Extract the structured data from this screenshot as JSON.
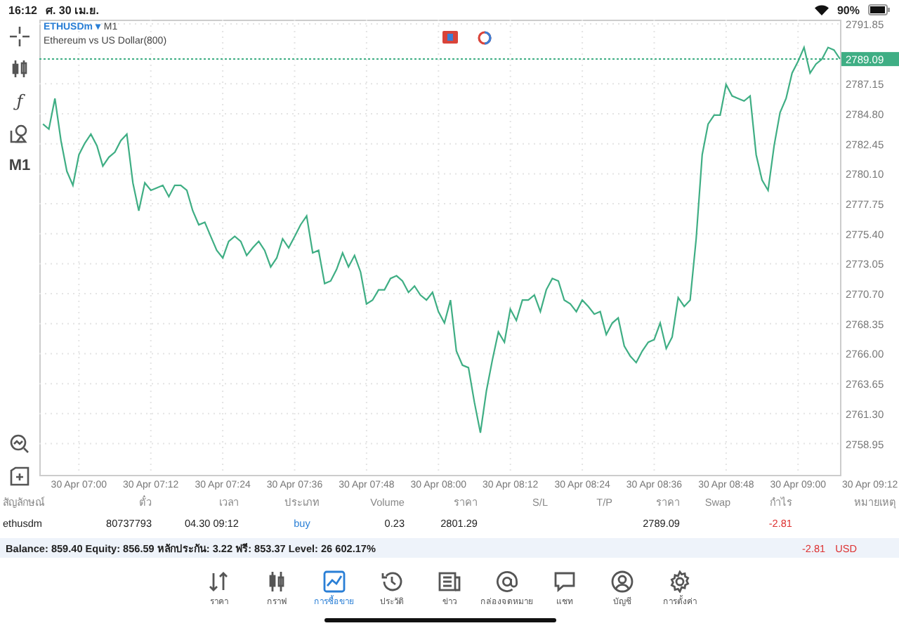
{
  "status_bar": {
    "time": "16:12",
    "date": "ศ. 30 เม.ย.",
    "battery": "90%"
  },
  "toolbar": [
    {
      "kind": "crosshair"
    },
    {
      "kind": "candles"
    },
    {
      "kind": "text",
      "label": "ƒ"
    },
    {
      "kind": "objects"
    },
    {
      "kind": "text",
      "label": "M1"
    }
  ],
  "toolbar_bottom": [
    {
      "kind": "zoom"
    },
    {
      "kind": "add"
    }
  ],
  "chart": {
    "caret": "▾",
    "timeframe": "M1",
    "description": "Ethereum vs US Dollar(800)",
    "chart_data": {
      "type": "line",
      "grid": true,
      "ylim": [
        2756.5,
        2792.18
      ],
      "yticks": [
        {
          "value": 2791.85,
          "label": "2791.85"
        },
        {
          "value": 2787.15,
          "label": "2787.15"
        },
        {
          "value": 2784.8,
          "label": "2784.80"
        },
        {
          "value": 2782.45,
          "label": "2782.45"
        },
        {
          "value": 2780.1,
          "label": "2780.10"
        },
        {
          "value": 2777.75,
          "label": "2777.75"
        },
        {
          "value": 2775.4,
          "label": "2775.40"
        },
        {
          "value": 2773.05,
          "label": "2773.05"
        },
        {
          "value": 2770.7,
          "label": "2770.70"
        },
        {
          "value": 2768.35,
          "label": "2768.35"
        },
        {
          "value": 2766.0,
          "label": "2766.00"
        },
        {
          "value": 2763.65,
          "label": "2763.65"
        },
        {
          "value": 2761.3,
          "label": "2761.30"
        },
        {
          "value": 2758.95,
          "label": "2758.95"
        }
      ],
      "categories": [
        null,
        null,
        null,
        null,
        null,
        null,
        "30 Apr 07:00",
        null,
        null,
        null,
        null,
        null,
        null,
        null,
        null,
        null,
        null,
        null,
        "30 Apr 07:12",
        null,
        null,
        null,
        null,
        null,
        null,
        null,
        null,
        null,
        null,
        null,
        "30 Apr 07:24",
        null,
        null,
        null,
        null,
        null,
        null,
        null,
        null,
        null,
        null,
        null,
        "30 Apr 07:36",
        null,
        null,
        null,
        null,
        null,
        null,
        null,
        null,
        null,
        null,
        null,
        "30 Apr 07:48",
        null,
        null,
        null,
        null,
        null,
        null,
        null,
        null,
        null,
        null,
        null,
        "30 Apr 08:00",
        null,
        null,
        null,
        null,
        null,
        null,
        null,
        null,
        null,
        null,
        null,
        "30 Apr 08:12",
        null,
        null,
        null,
        null,
        null,
        null,
        null,
        null,
        null,
        null,
        null,
        "30 Apr 08:24",
        null,
        null,
        null,
        null,
        null,
        null,
        null,
        null,
        null,
        null,
        null,
        "30 Apr 08:36",
        null,
        null,
        null,
        null,
        null,
        null,
        null,
        null,
        null,
        null,
        null,
        "30 Apr 08:48",
        null,
        null,
        null,
        null,
        null,
        null,
        null,
        null,
        null,
        null,
        null,
        "30 Apr 09:00",
        null,
        null,
        null,
        null,
        null,
        null,
        null,
        null,
        null,
        null,
        null,
        "30 Apr 09:12"
      ],
      "ref_lines": [
        {
          "axis": "y",
          "value": 2789.09,
          "label": "2789.09",
          "color": "#3fae84"
        }
      ],
      "series": [
        {
          "name": "ETHUSDm",
          "color": "#3fae84",
          "values": [
            2784.0,
            2783.6,
            2786.0,
            2782.7,
            2780.3,
            2779.2,
            2781.6,
            2782.5,
            2783.2,
            2782.3,
            2780.7,
            2781.4,
            2781.8,
            2782.7,
            2783.2,
            2779.4,
            2777.2,
            2779.4,
            2778.8,
            2779.0,
            2779.2,
            2778.3,
            2779.2,
            2779.2,
            2778.8,
            2777.2,
            2776.1,
            2776.3,
            2775.2,
            2774.1,
            2773.5,
            2774.8,
            2775.2,
            2774.8,
            2773.7,
            2774.3,
            2774.8,
            2774.1,
            2772.8,
            2773.5,
            2775.0,
            2774.3,
            2775.2,
            2776.1,
            2776.8,
            2773.9,
            2774.1,
            2771.5,
            2771.7,
            2772.6,
            2773.9,
            2772.8,
            2773.7,
            2772.4,
            2769.9,
            2770.2,
            2771.0,
            2771.0,
            2771.9,
            2772.1,
            2771.7,
            2770.8,
            2771.3,
            2770.6,
            2770.2,
            2770.8,
            2769.3,
            2768.4,
            2770.2,
            2766.2,
            2765.1,
            2764.9,
            2762.2,
            2759.8,
            2763.1,
            2765.5,
            2767.7,
            2766.9,
            2769.5,
            2768.6,
            2770.2,
            2770.2,
            2770.6,
            2769.3,
            2771.0,
            2771.9,
            2771.7,
            2770.2,
            2769.9,
            2769.3,
            2770.2,
            2769.7,
            2769.1,
            2769.3,
            2767.5,
            2768.4,
            2768.8,
            2766.6,
            2765.8,
            2765.3,
            2766.2,
            2766.9,
            2767.1,
            2768.4,
            2766.4,
            2767.3,
            2770.4,
            2769.7,
            2770.2,
            2775.0,
            2781.6,
            2784.0,
            2784.7,
            2784.7,
            2787.1,
            2786.2,
            2786.0,
            2785.8,
            2786.2,
            2781.6,
            2779.6,
            2778.8,
            2782.3,
            2784.9,
            2786.0,
            2788.0,
            2788.9,
            2790.0,
            2788.0,
            2788.7,
            2789.1,
            2790.0,
            2789.8,
            2789.1,
            null,
            null,
            null,
            null,
            null
          ]
        }
      ]
    }
  },
  "table": {
    "columns": [
      "สัญลักษณ์",
      "ตั๋ว",
      "เวลา",
      "ประเภท",
      "Volume",
      "ราคา",
      "S/L",
      "T/P",
      "ราคา",
      "Swap",
      "กำไร",
      "หมายเหตุ"
    ],
    "rows": [
      {
        "kind": "position",
        "cells": [
          "ethusdm",
          "80737793",
          "04.30 09:12",
          "buy",
          "0.23",
          "2801.29",
          "",
          "",
          "2789.09",
          "",
          "-2.81",
          ""
        ]
      }
    ]
  },
  "summary": {
    "text": "Balance: 859.40 Equity: 856.59 หลักประกัน: 3.22 ฟรี: 853.37 Level: 26 602.17%",
    "profit": "-2.81",
    "currency": "USD"
  },
  "tabs": [
    {
      "kind": "quotes",
      "label": "ราคา",
      "selected": false
    },
    {
      "kind": "chart",
      "label": "กราฟ",
      "selected": false
    },
    {
      "kind": "trade",
      "label": "การซื้อขาย",
      "selected": true
    },
    {
      "kind": "history",
      "label": "ประวัติ",
      "selected": false
    },
    {
      "kind": "news",
      "label": "ข่าว",
      "selected": false
    },
    {
      "kind": "mail",
      "label": "กล่องจดหมาย",
      "selected": false
    },
    {
      "kind": "chat",
      "label": "แชท",
      "selected": false
    },
    {
      "kind": "account",
      "label": "บัญชี",
      "selected": false
    },
    {
      "kind": "settings",
      "label": "การตั้งค่า",
      "selected": false
    }
  ]
}
